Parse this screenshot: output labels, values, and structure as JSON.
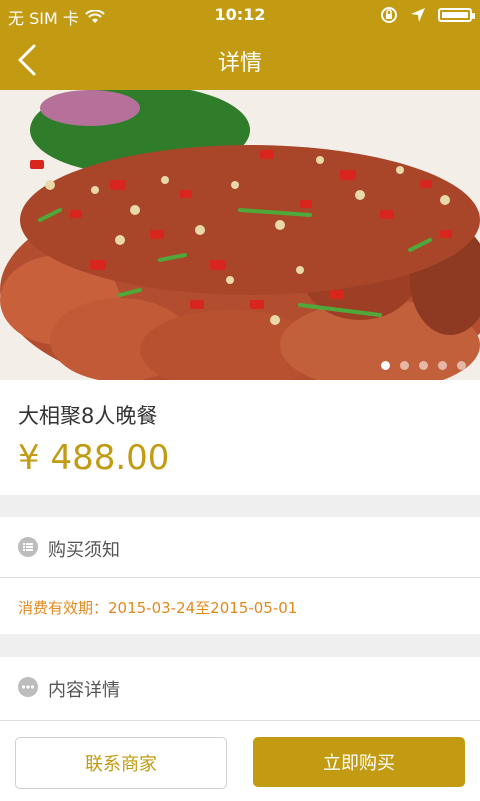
{
  "status_bar": {
    "carrier": "无 SIM 卡",
    "time": "10:12"
  },
  "nav": {
    "title": "详情"
  },
  "hero": {
    "slide_count": 5,
    "active_slide": 0
  },
  "product": {
    "title": "大相聚8人晚餐",
    "price": "¥ 488.00"
  },
  "purchase_notice": {
    "heading": "购买须知",
    "validity": "消费有效期：2015-03-24至2015-05-01"
  },
  "content_details": {
    "heading": "内容详情"
  },
  "bottom_bar": {
    "contact_label": "联系商家",
    "buy_label": "立即购买"
  }
}
